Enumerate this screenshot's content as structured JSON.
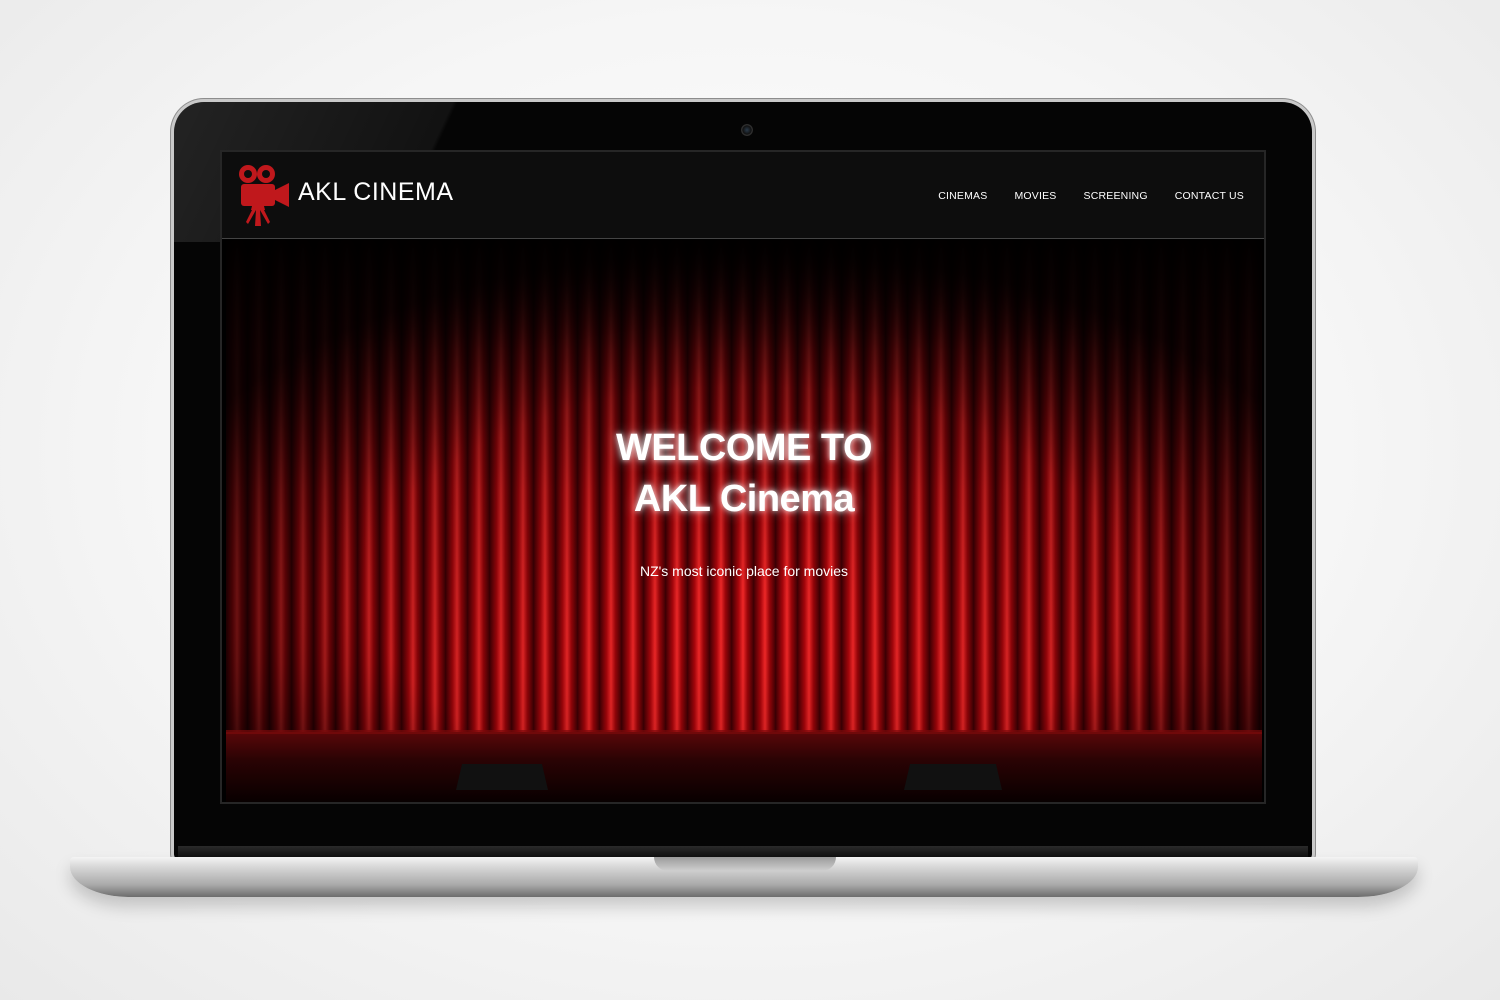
{
  "brand": {
    "name": "AKL CINEMA",
    "logo_icon": "movie-camera-icon",
    "logo_color": "#c0181c"
  },
  "nav": {
    "items": [
      {
        "label": "CINEMAS"
      },
      {
        "label": "MOVIES"
      },
      {
        "label": "SCREENING"
      },
      {
        "label": "CONTACT US"
      }
    ]
  },
  "hero": {
    "title_line1": "WELCOME TO",
    "title_line2": "AKL Cinema",
    "subtitle": "NZ's most iconic place for movies",
    "background": "red-stage-curtain",
    "accent_color": "#c80f14"
  }
}
